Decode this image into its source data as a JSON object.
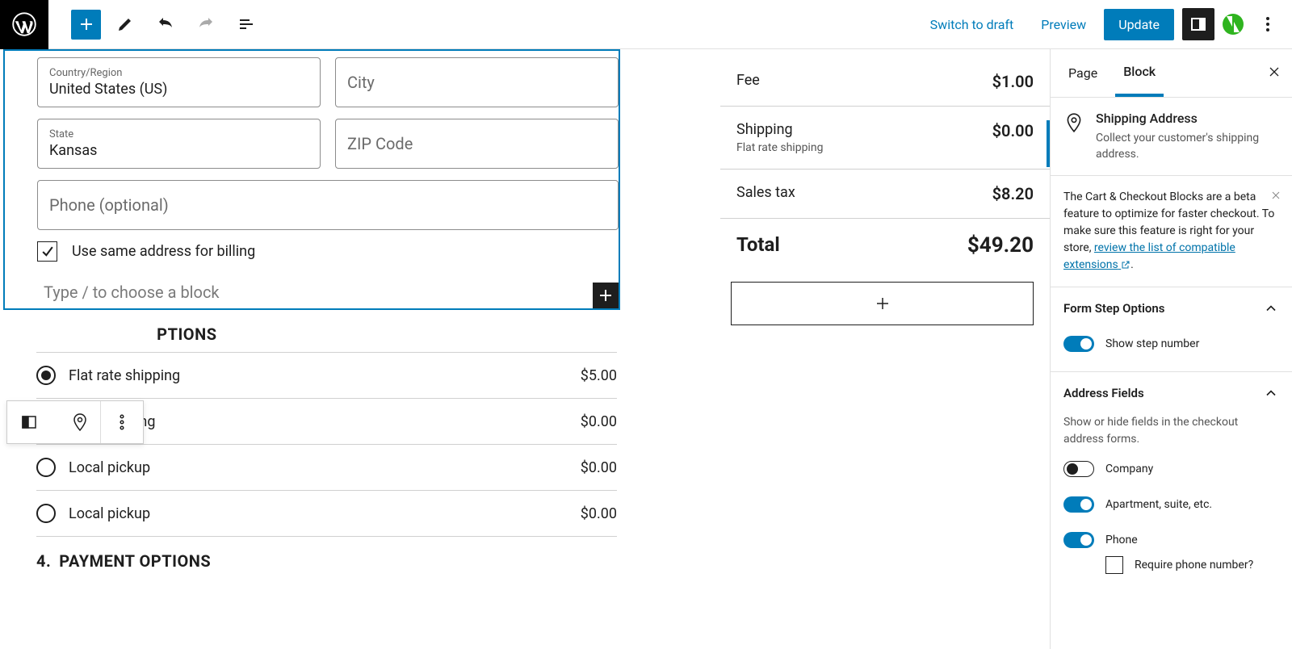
{
  "toolbar": {
    "switch_draft": "Switch to draft",
    "preview": "Preview",
    "update": "Update"
  },
  "form": {
    "country_label": "Country/Region",
    "country_value": "United States (US)",
    "city_ph": "City",
    "state_label": "State",
    "state_value": "Kansas",
    "zip_ph": "ZIP Code",
    "phone_ph": "Phone (optional)",
    "same_billing": "Use same address for billing",
    "block_prompt": "Type / to choose a block"
  },
  "shipping_options": {
    "heading_suffix": "PTIONS",
    "items": [
      {
        "label": "Flat rate shipping",
        "price": "$5.00",
        "selected": true
      },
      {
        "label": "Free shipping",
        "price": "$0.00",
        "selected": false
      },
      {
        "label": "Local pickup",
        "price": "$0.00",
        "selected": false
      },
      {
        "label": "Local pickup",
        "price": "$0.00",
        "selected": false
      }
    ]
  },
  "payment": {
    "num": "4.",
    "heading": "PAYMENT OPTIONS"
  },
  "summary": {
    "fee": {
      "label": "Fee",
      "value": "$1.00"
    },
    "shipping": {
      "label": "Shipping",
      "sub": "Flat rate shipping",
      "value": "$0.00"
    },
    "tax": {
      "label": "Sales tax",
      "value": "$8.20"
    },
    "total": {
      "label": "Total",
      "value": "$49.20"
    }
  },
  "sidebar": {
    "tab_page": "Page",
    "tab_block": "Block",
    "block_title": "Shipping Address",
    "block_desc": "Collect your customer's shipping address.",
    "notice_a": "The Cart & Checkout Blocks are a beta feature to optimize for faster checkout. To make sure this feature is right for your store, ",
    "notice_link": "review the list of compatible extensions",
    "notice_period": ".",
    "form_step": {
      "heading": "Form Step Options",
      "show_step": "Show step number"
    },
    "address_fields": {
      "heading": "Address Fields",
      "hint": "Show or hide fields in the checkout address forms.",
      "company": "Company",
      "apt": "Apartment, suite, etc.",
      "phone": "Phone",
      "require_phone": "Require phone number?"
    }
  }
}
